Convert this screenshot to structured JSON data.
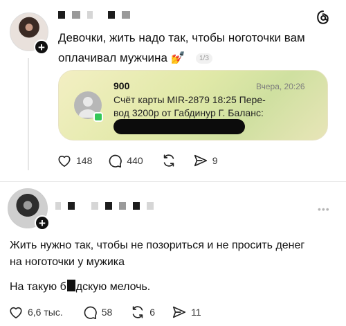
{
  "post1": {
    "text_line1": "Девочки, жить надо так, чтобы ноготочки вам",
    "text_line2": "оплачивал мужчина 💅",
    "media_counter": "1/3",
    "notification": {
      "sender": "900",
      "time": "Вчера, 20:26",
      "line1": "Счёт карты MIR-2879 18:25 Пере-",
      "line2": "вод 3200р от Габдинур Г. Баланс:"
    },
    "actions": {
      "likes": "148",
      "comments": "440",
      "shares": "9"
    }
  },
  "post2": {
    "text_line1": "Жить нужно так, чтобы не позориться и не просить денег",
    "text_line2": "на ноготочки у мужика",
    "text_line3_before": "На такую б",
    "text_line3_after": "дскую мелочь.",
    "more": "•••",
    "actions": {
      "likes": "6,6 тыс.",
      "comments": "58",
      "reposts": "6",
      "shares": "11"
    }
  },
  "colors": {
    "card_gradient_start": "#f3efc3",
    "card_gradient_end": "#cfe0a0",
    "text": "#111111",
    "muted": "#9a9a9a"
  }
}
